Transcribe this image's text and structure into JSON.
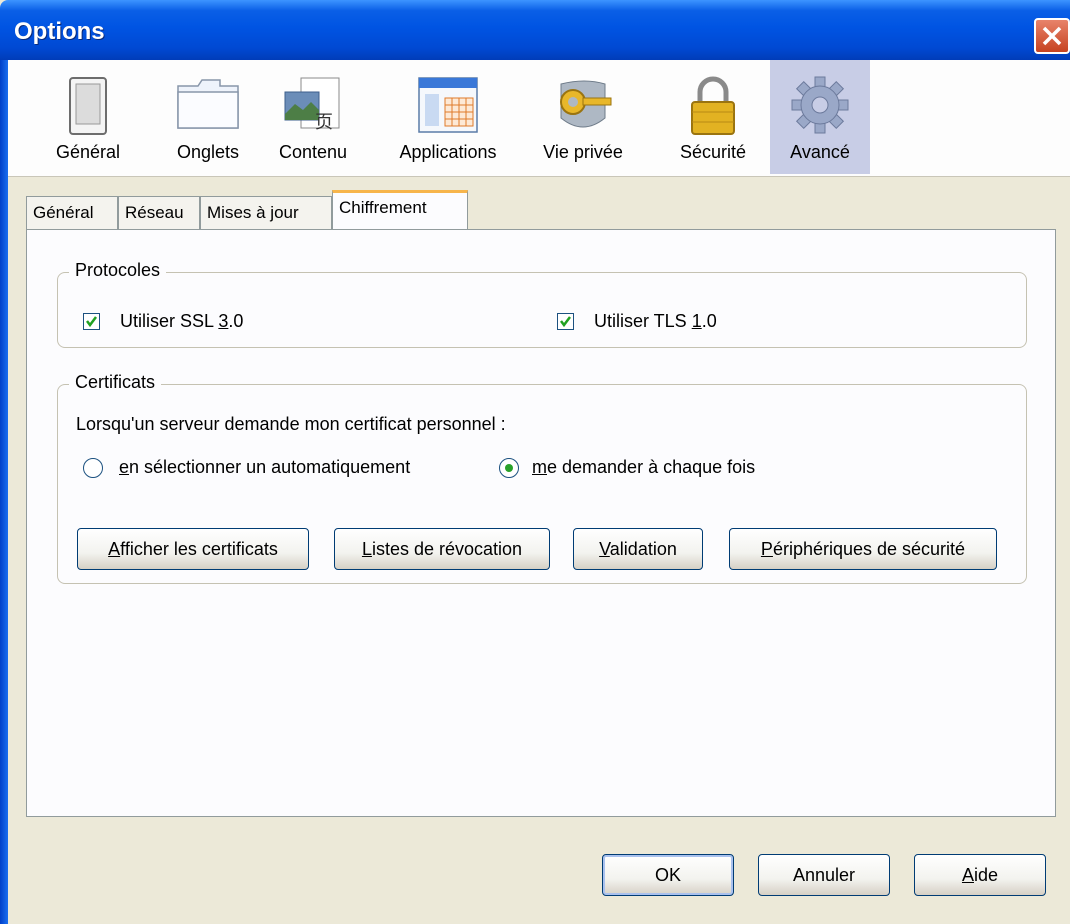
{
  "window": {
    "title": "Options"
  },
  "toolbar": {
    "items": [
      {
        "label": "Général",
        "icon": "general-switch-icon"
      },
      {
        "label": "Onglets",
        "icon": "tabs-folder-icon"
      },
      {
        "label": "Contenu",
        "icon": "content-icon"
      },
      {
        "label": "Applications",
        "icon": "applications-window-icon"
      },
      {
        "label": "Vie privée",
        "icon": "privacy-key-icon"
      },
      {
        "label": "Sécurité",
        "icon": "padlock-icon"
      },
      {
        "label": "Avancé",
        "icon": "gear-icon"
      }
    ],
    "selected": "Avancé"
  },
  "tabs": [
    {
      "label": "Général"
    },
    {
      "label": "Réseau"
    },
    {
      "label": "Mises à jour"
    },
    {
      "label": "Chiffrement"
    }
  ],
  "active_tab": "Chiffrement",
  "protocols": {
    "title": "Protocoles",
    "ssl": {
      "pre": "Utiliser SSL ",
      "key": "3",
      "post": ".0",
      "checked": true
    },
    "tls": {
      "pre": "Utiliser TLS ",
      "key": "1",
      "post": ".0",
      "checked": true
    }
  },
  "certificates": {
    "title": "Certificats",
    "prompt": "Lorsqu'un serveur demande mon certificat personnel :",
    "radio_auto": {
      "key": "e",
      "rest": "n sélectionner un automatiquement",
      "selected": false
    },
    "radio_ask": {
      "key": "m",
      "rest": "e demander à chaque fois",
      "selected": true
    },
    "buttons": {
      "view": {
        "key": "A",
        "rest": "fficher les certificats"
      },
      "revocation": {
        "key": "L",
        "rest": "istes de révocation"
      },
      "validation": {
        "key": "V",
        "rest": "alidation"
      },
      "devices": {
        "key": "P",
        "rest": "ériphériques de sécurité"
      }
    }
  },
  "footer": {
    "ok": "OK",
    "cancel": "Annuler",
    "help": {
      "key": "A",
      "rest": "ide"
    }
  },
  "colors": {
    "accent": "#0054e3",
    "selected_toolbar": "#c8cde6",
    "check": "#29a129"
  }
}
